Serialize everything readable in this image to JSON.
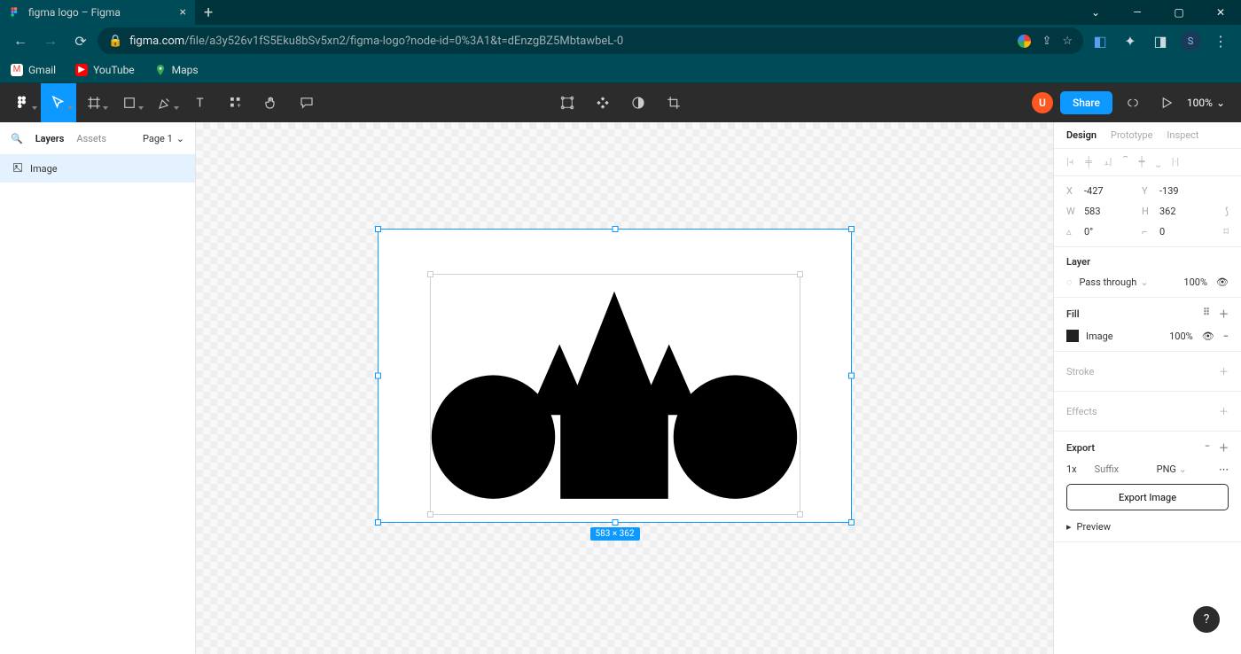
{
  "browser": {
    "tab_title": "figma logo – Figma",
    "url_host": "figma.com",
    "url_path": "/file/a3y526v1fS5Eku8bSv5xn2/figma-logo?node-id=0%3A1&t=dEnzgBZ5MbtawbeL-0"
  },
  "bookmarks": {
    "gmail": "Gmail",
    "youtube": "YouTube",
    "maps": "Maps"
  },
  "toolbar": {
    "avatar_letter": "U",
    "share_label": "Share",
    "zoom_label": "100%"
  },
  "left_panel": {
    "tab_layers": "Layers",
    "tab_assets": "Assets",
    "page_label": "Page 1",
    "layer_name": "Image"
  },
  "canvas": {
    "dims_label": "583 × 362"
  },
  "right_panel": {
    "tab_design": "Design",
    "tab_prototype": "Prototype",
    "tab_inspect": "Inspect",
    "x_label": "X",
    "x_val": "-427",
    "y_label": "Y",
    "y_val": "-139",
    "w_label": "W",
    "w_val": "583",
    "h_label": "H",
    "h_val": "362",
    "rot_label": "⟲",
    "rot_val": "0°",
    "radius_label": "⌐",
    "radius_val": "0",
    "layer_head": "Layer",
    "blend_mode": "Pass through",
    "layer_opacity": "100%",
    "fill_head": "Fill",
    "fill_type": "Image",
    "fill_opacity": "100%",
    "stroke_head": "Stroke",
    "effects_head": "Effects",
    "export_head": "Export",
    "export_scale": "1x",
    "export_suffix_placeholder": "Suffix",
    "export_format": "PNG",
    "export_button": "Export Image",
    "preview_label": "Preview"
  }
}
